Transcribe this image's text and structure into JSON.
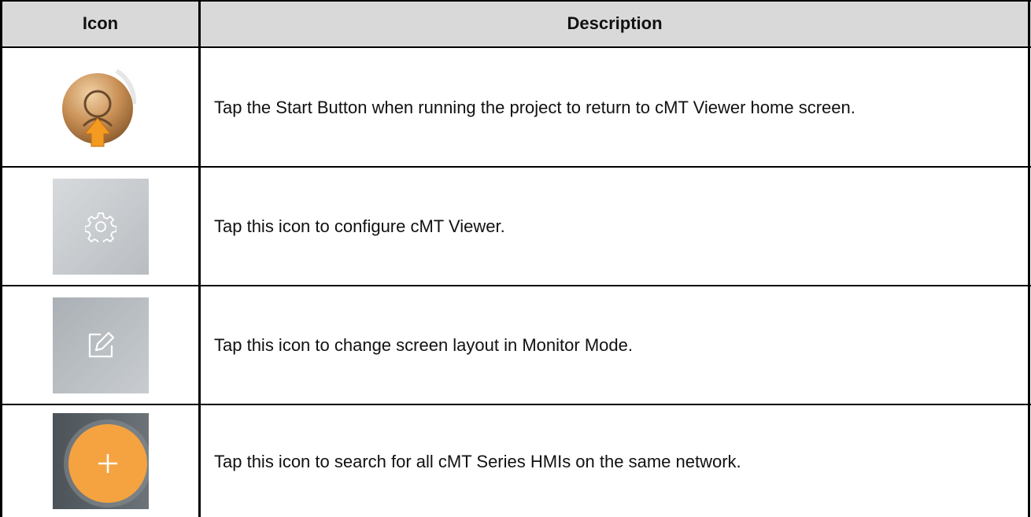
{
  "table": {
    "headers": {
      "icon": "Icon",
      "description": "Description"
    },
    "rows": [
      {
        "icon": "start-button-icon",
        "description": "Tap the Start Button when running the project to return to cMT Viewer home screen."
      },
      {
        "icon": "gear-icon",
        "description": "Tap this icon to configure cMT Viewer."
      },
      {
        "icon": "edit-icon",
        "description": "Tap this icon to change screen layout in Monitor Mode."
      },
      {
        "icon": "plus-icon",
        "description": "Tap this icon to search for all cMT Series HMIs on the same network."
      }
    ]
  },
  "colors": {
    "header_bg": "#d9d9d9",
    "border": "#000000",
    "accent_orange": "#f5a340"
  }
}
